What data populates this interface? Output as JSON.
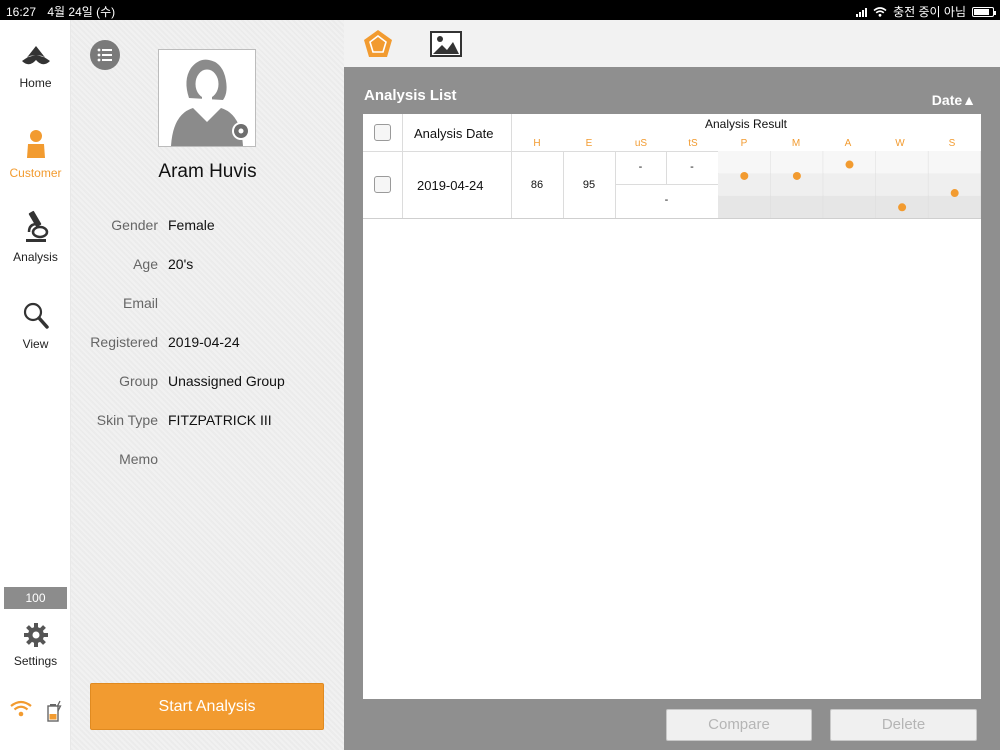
{
  "status_bar": {
    "time": "16:27",
    "date": "4월 24일 (수)",
    "charging": "충전 중이 아님"
  },
  "nav": {
    "items": [
      {
        "label": "Home",
        "icon": "home-logo-icon",
        "active": false
      },
      {
        "label": "Customer",
        "icon": "person-icon",
        "active": true
      },
      {
        "label": "Analysis",
        "icon": "microscope-icon",
        "active": false
      },
      {
        "label": "View",
        "icon": "magnifier-icon",
        "active": false
      },
      {
        "label": "Settings",
        "icon": "gear-icon",
        "active": false
      }
    ],
    "battery_level": "100",
    "accent_color": "#f29b30"
  },
  "customer": {
    "name": "Aram Huvis",
    "fields": [
      {
        "label": "Gender",
        "value": "Female"
      },
      {
        "label": "Age",
        "value": "20's"
      },
      {
        "label": "Email",
        "value": ""
      },
      {
        "label": "Registered",
        "value": "2019-04-24"
      },
      {
        "label": "Group",
        "value": "Unassigned Group"
      },
      {
        "label": "Skin Type",
        "value": "FITZPATRICK III"
      },
      {
        "label": "Memo",
        "value": ""
      }
    ],
    "start_button": "Start Analysis"
  },
  "main": {
    "tabs": [
      {
        "icon": "pentagon-chart-icon",
        "active": true
      },
      {
        "icon": "image-gallery-icon",
        "active": false
      }
    ],
    "title": "Analysis List",
    "sort_label": "Date▲",
    "table": {
      "col_date": "Analysis Date",
      "col_result": "Analysis Result",
      "sub_headers": [
        "H",
        "E",
        "uS",
        "tS",
        "P",
        "M",
        "A",
        "W",
        "S"
      ],
      "rows": [
        {
          "date": "2019-04-24",
          "H": "86",
          "E": "95",
          "uS": "-",
          "tS": "-",
          "uS_tS_combined": "-",
          "levels": {
            "P": 0.65,
            "M": 0.65,
            "A": 0.85,
            "W": 0.1,
            "S": 0.35
          }
        }
      ]
    },
    "compare_button": "Compare",
    "delete_button": "Delete"
  }
}
